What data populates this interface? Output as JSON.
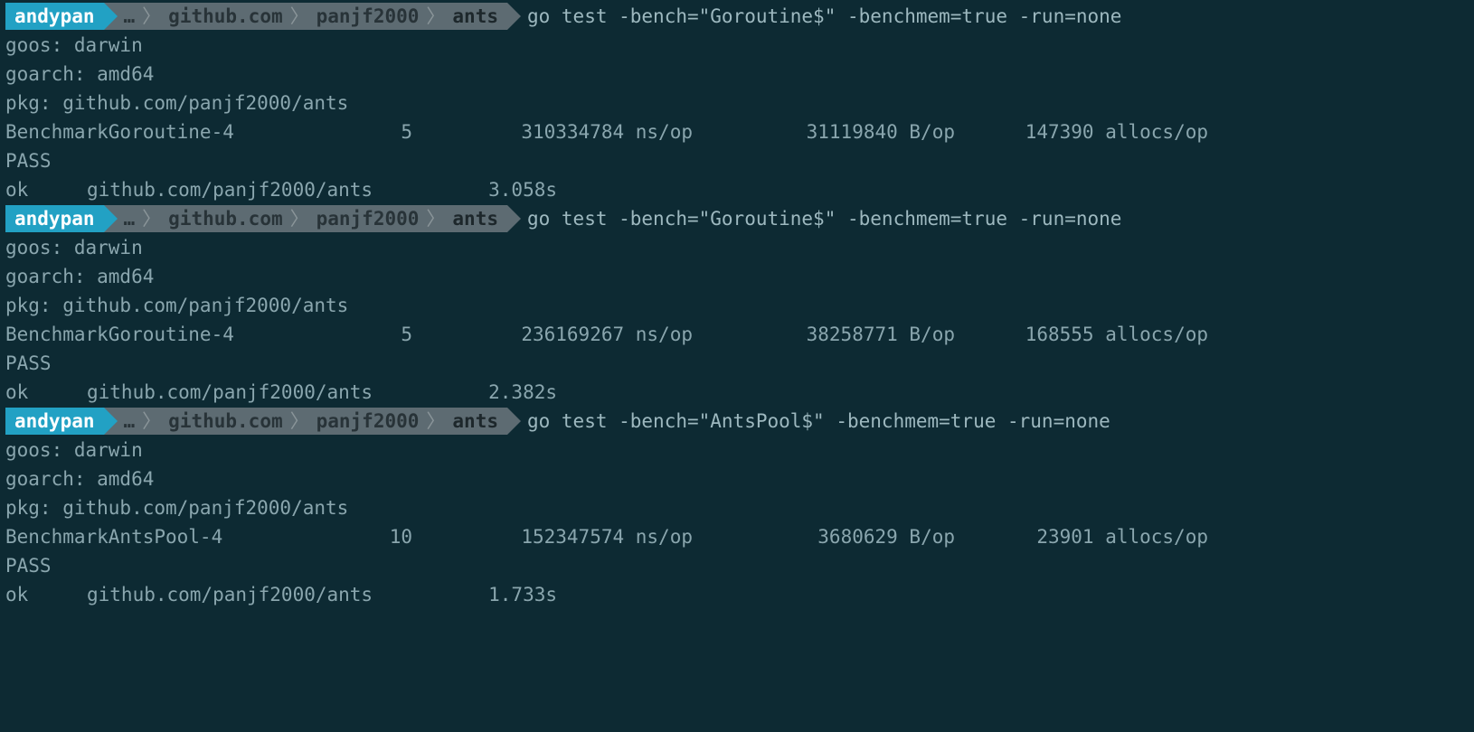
{
  "prompt": {
    "user": "andypan",
    "path": [
      "…",
      "github.com",
      "panjf2000",
      "ants"
    ]
  },
  "runs": [
    {
      "command": "go test -bench=\"Goroutine$\" -benchmem=true -run=none",
      "header": {
        "goos": "goos: darwin",
        "goarch": "goarch: amd64",
        "pkg": "pkg: github.com/panjf2000/ants"
      },
      "bench": {
        "name": "BenchmarkGoroutine-4",
        "n": "5",
        "ns_op": "310334784 ns/op",
        "b_op": "31119840 B/op",
        "allocs_op": "147390 allocs/op"
      },
      "pass": "PASS",
      "ok": {
        "label": "ok",
        "pkg": "github.com/panjf2000/ants",
        "time": "3.058s"
      }
    },
    {
      "command": "go test -bench=\"Goroutine$\" -benchmem=true -run=none",
      "header": {
        "goos": "goos: darwin",
        "goarch": "goarch: amd64",
        "pkg": "pkg: github.com/panjf2000/ants"
      },
      "bench": {
        "name": "BenchmarkGoroutine-4",
        "n": "5",
        "ns_op": "236169267 ns/op",
        "b_op": "38258771 B/op",
        "allocs_op": "168555 allocs/op"
      },
      "pass": "PASS",
      "ok": {
        "label": "ok",
        "pkg": "github.com/panjf2000/ants",
        "time": "2.382s"
      }
    },
    {
      "command": "go test -bench=\"AntsPool$\" -benchmem=true -run=none",
      "header": {
        "goos": "goos: darwin",
        "goarch": "goarch: amd64",
        "pkg": "pkg: github.com/panjf2000/ants"
      },
      "bench": {
        "name": "BenchmarkAntsPool-4",
        "n": "10",
        "ns_op": "152347574 ns/op",
        "b_op": "3680629 B/op",
        "allocs_op": "23901 allocs/op"
      },
      "pass": "PASS",
      "ok": {
        "label": "ok",
        "pkg": "github.com/panjf2000/ants",
        "time": "1.733s"
      }
    }
  ]
}
